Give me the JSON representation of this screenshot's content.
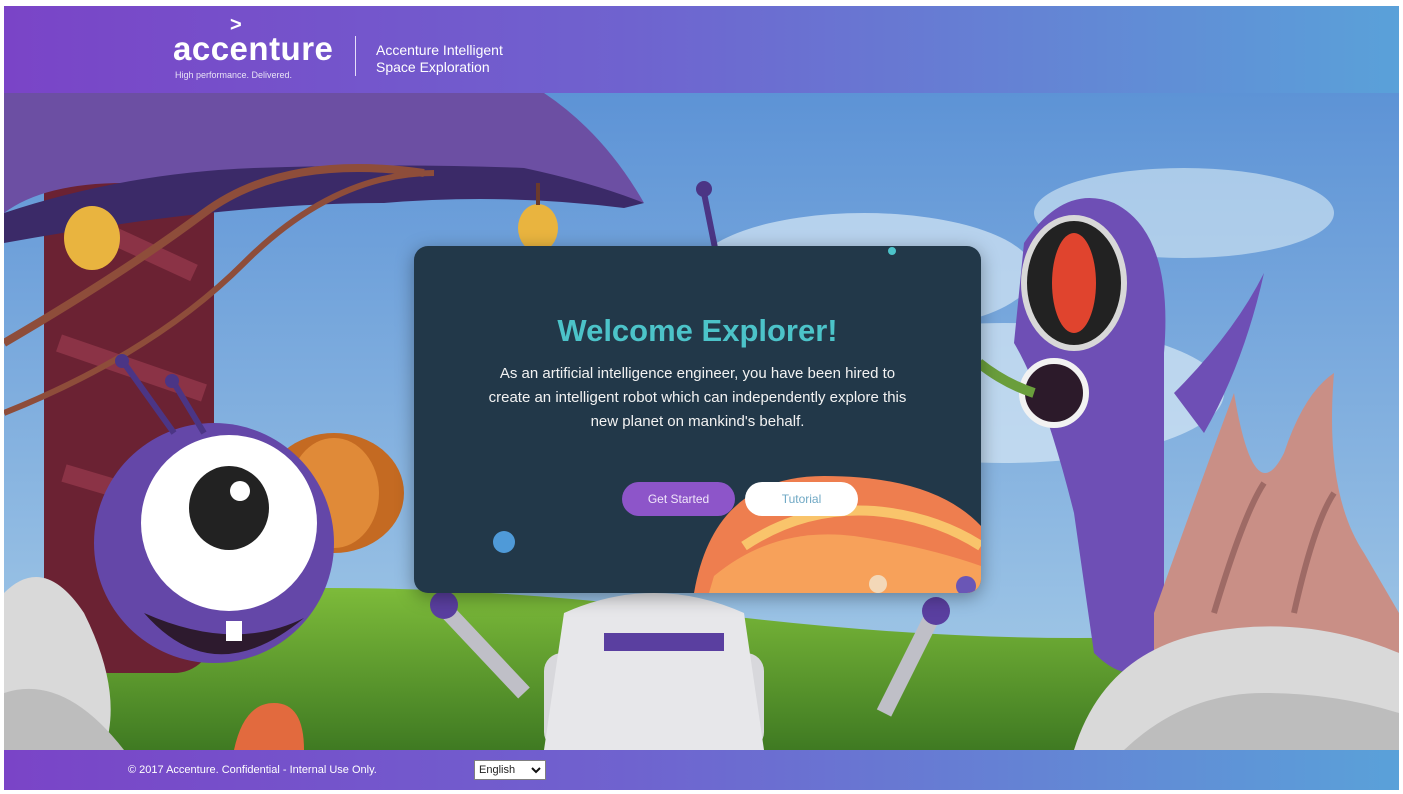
{
  "header": {
    "logo": {
      "word": "accenture",
      "chevron": ">",
      "tagline": "High performance. Delivered."
    },
    "title_line1": "Accenture Intelligent",
    "title_line2": "Space Exploration"
  },
  "modal": {
    "title": "Welcome Explorer!",
    "body": "As an artificial intelligence engineer, you have been hired to create an intelligent robot which can independently explore this new planet on mankind's behalf.",
    "buttons": {
      "get_started": "Get Started",
      "tutorial": "Tutorial"
    }
  },
  "footer": {
    "copyright": "© 2017 Accenture. Confidential - Internal Use Only.",
    "language": {
      "selected": "English",
      "icon": "chevron-down-icon"
    }
  },
  "colors": {
    "header_start": "#7a44c7",
    "header_end": "#5aa1d9",
    "modal_bg": "#223849",
    "title": "#4cc3c9",
    "primary_button": "#8d55c9",
    "secondary_button": "#ffffff"
  }
}
